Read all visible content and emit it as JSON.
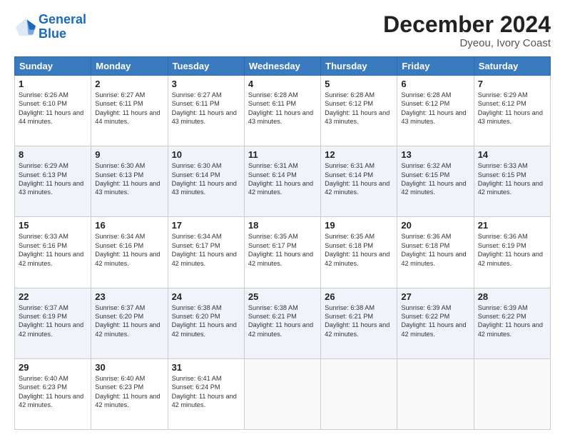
{
  "logo": {
    "line1": "General",
    "line2": "Blue"
  },
  "title": "December 2024",
  "subtitle": "Dyeou, Ivory Coast",
  "days_of_week": [
    "Sunday",
    "Monday",
    "Tuesday",
    "Wednesday",
    "Thursday",
    "Friday",
    "Saturday"
  ],
  "weeks": [
    [
      {
        "day": "1",
        "sunrise": "6:26 AM",
        "sunset": "6:10 PM",
        "daylight": "11 hours and 44 minutes."
      },
      {
        "day": "2",
        "sunrise": "6:27 AM",
        "sunset": "6:11 PM",
        "daylight": "11 hours and 44 minutes."
      },
      {
        "day": "3",
        "sunrise": "6:27 AM",
        "sunset": "6:11 PM",
        "daylight": "11 hours and 43 minutes."
      },
      {
        "day": "4",
        "sunrise": "6:28 AM",
        "sunset": "6:11 PM",
        "daylight": "11 hours and 43 minutes."
      },
      {
        "day": "5",
        "sunrise": "6:28 AM",
        "sunset": "6:12 PM",
        "daylight": "11 hours and 43 minutes."
      },
      {
        "day": "6",
        "sunrise": "6:28 AM",
        "sunset": "6:12 PM",
        "daylight": "11 hours and 43 minutes."
      },
      {
        "day": "7",
        "sunrise": "6:29 AM",
        "sunset": "6:12 PM",
        "daylight": "11 hours and 43 minutes."
      }
    ],
    [
      {
        "day": "8",
        "sunrise": "6:29 AM",
        "sunset": "6:13 PM",
        "daylight": "11 hours and 43 minutes."
      },
      {
        "day": "9",
        "sunrise": "6:30 AM",
        "sunset": "6:13 PM",
        "daylight": "11 hours and 43 minutes."
      },
      {
        "day": "10",
        "sunrise": "6:30 AM",
        "sunset": "6:14 PM",
        "daylight": "11 hours and 43 minutes."
      },
      {
        "day": "11",
        "sunrise": "6:31 AM",
        "sunset": "6:14 PM",
        "daylight": "11 hours and 42 minutes."
      },
      {
        "day": "12",
        "sunrise": "6:31 AM",
        "sunset": "6:14 PM",
        "daylight": "11 hours and 42 minutes."
      },
      {
        "day": "13",
        "sunrise": "6:32 AM",
        "sunset": "6:15 PM",
        "daylight": "11 hours and 42 minutes."
      },
      {
        "day": "14",
        "sunrise": "6:33 AM",
        "sunset": "6:15 PM",
        "daylight": "11 hours and 42 minutes."
      }
    ],
    [
      {
        "day": "15",
        "sunrise": "6:33 AM",
        "sunset": "6:16 PM",
        "daylight": "11 hours and 42 minutes."
      },
      {
        "day": "16",
        "sunrise": "6:34 AM",
        "sunset": "6:16 PM",
        "daylight": "11 hours and 42 minutes."
      },
      {
        "day": "17",
        "sunrise": "6:34 AM",
        "sunset": "6:17 PM",
        "daylight": "11 hours and 42 minutes."
      },
      {
        "day": "18",
        "sunrise": "6:35 AM",
        "sunset": "6:17 PM",
        "daylight": "11 hours and 42 minutes."
      },
      {
        "day": "19",
        "sunrise": "6:35 AM",
        "sunset": "6:18 PM",
        "daylight": "11 hours and 42 minutes."
      },
      {
        "day": "20",
        "sunrise": "6:36 AM",
        "sunset": "6:18 PM",
        "daylight": "11 hours and 42 minutes."
      },
      {
        "day": "21",
        "sunrise": "6:36 AM",
        "sunset": "6:19 PM",
        "daylight": "11 hours and 42 minutes."
      }
    ],
    [
      {
        "day": "22",
        "sunrise": "6:37 AM",
        "sunset": "6:19 PM",
        "daylight": "11 hours and 42 minutes."
      },
      {
        "day": "23",
        "sunrise": "6:37 AM",
        "sunset": "6:20 PM",
        "daylight": "11 hours and 42 minutes."
      },
      {
        "day": "24",
        "sunrise": "6:38 AM",
        "sunset": "6:20 PM",
        "daylight": "11 hours and 42 minutes."
      },
      {
        "day": "25",
        "sunrise": "6:38 AM",
        "sunset": "6:21 PM",
        "daylight": "11 hours and 42 minutes."
      },
      {
        "day": "26",
        "sunrise": "6:38 AM",
        "sunset": "6:21 PM",
        "daylight": "11 hours and 42 minutes."
      },
      {
        "day": "27",
        "sunrise": "6:39 AM",
        "sunset": "6:22 PM",
        "daylight": "11 hours and 42 minutes."
      },
      {
        "day": "28",
        "sunrise": "6:39 AM",
        "sunset": "6:22 PM",
        "daylight": "11 hours and 42 minutes."
      }
    ],
    [
      {
        "day": "29",
        "sunrise": "6:40 AM",
        "sunset": "6:23 PM",
        "daylight": "11 hours and 42 minutes."
      },
      {
        "day": "30",
        "sunrise": "6:40 AM",
        "sunset": "6:23 PM",
        "daylight": "11 hours and 42 minutes."
      },
      {
        "day": "31",
        "sunrise": "6:41 AM",
        "sunset": "6:24 PM",
        "daylight": "11 hours and 42 minutes."
      },
      null,
      null,
      null,
      null
    ]
  ],
  "labels": {
    "sunrise": "Sunrise: ",
    "sunset": "Sunset: ",
    "daylight": "Daylight: "
  }
}
